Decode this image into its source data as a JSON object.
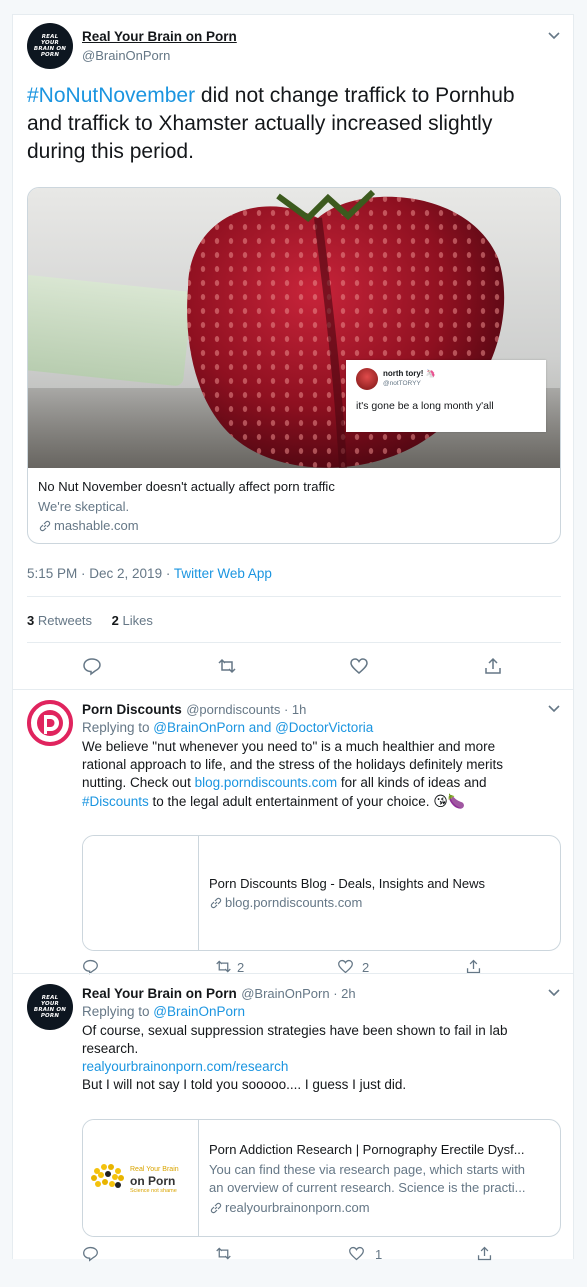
{
  "main_tweet": {
    "author_name": "Real Your Brain on Porn",
    "author_handle": "@BrainOnPorn",
    "avatar_text": "REAL YOUR BRAIN ON PORN",
    "hashtag": "#NoNutNovember",
    "text_rest_line1": " did not change traffick to Pornhub",
    "text_line2": "and traffick to Xhamster actually increased slightly",
    "text_line3": "during this period.",
    "card": {
      "embedded_name": "north tory! 🦄",
      "embedded_handle": "@notTORYY",
      "embedded_text": "it's gone be a long month y'all",
      "title": "No Nut November doesn't actually affect porn traffic",
      "description": "We're skeptical.",
      "domain": "mashable.com"
    },
    "timestamp": "5:15 PM · Dec 2, 2019 · ",
    "source": "Twitter Web App",
    "retweets_count": "3",
    "retweets_label": " Retweets",
    "likes_count": "2",
    "likes_label": " Likes"
  },
  "reply1": {
    "author_name": "Porn Discounts",
    "author_handle": "@porndiscounts · 1h",
    "replying_label": "Replying to ",
    "replying_to1": "@BrainOnPorn",
    "replying_and": " and ",
    "replying_to2": "@DoctorVictoria",
    "line1": "We believe \"nut whenever you need to\" is a much healthier and more",
    "line2": "rational approach to life, and the stress of the holidays definitely merits",
    "line3a": "nutting. Check out ",
    "line3_link": "blog.porndiscounts.com",
    "line3b": " for all kinds of ideas and",
    "line4_hashtag": "#Discounts",
    "line4b": " to the legal adult entertainment of your choice. ",
    "emoji": "😘🍆",
    "card": {
      "title": "Porn Discounts Blog - Deals, Insights and News",
      "domain": "blog.porndiscounts.com"
    },
    "retweets": "2",
    "likes": "2"
  },
  "reply2": {
    "author_name": "Real Your Brain on Porn",
    "author_handle": "@BrainOnPorn · 2h",
    "avatar_text": "REAL YOUR BRAIN ON PORN",
    "replying_label": "Replying to ",
    "replying_to": "@BrainOnPorn",
    "line1": "Of course, sexual suppression strategies have been shown to fail in lab",
    "line2": "research.",
    "link": "realyourbrainonporn.com/research",
    "line4": "But I will not say I told you sooooo.... I guess I just did.",
    "card": {
      "logo_line1": "Real Your Brain",
      "logo_line2": "on Porn",
      "logo_line3": "Science not shame",
      "title": "Porn Addiction Research | Pornography Erectile Dysf...",
      "desc1": "You can find these via research page, which starts with",
      "desc2": "an overview of current research. Science is the practi...",
      "domain": "realyourbrainonporn.com"
    },
    "likes": "1"
  },
  "colors": {
    "link": "#1b95e0",
    "gray": "#657786",
    "border": "#e6ecf0",
    "card_border": "#ccd6dd"
  }
}
